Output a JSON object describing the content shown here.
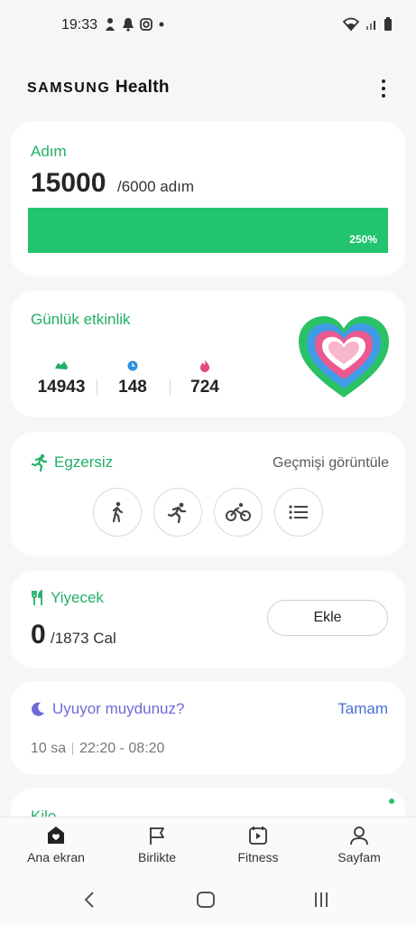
{
  "status_bar": {
    "time": "19:33"
  },
  "header": {
    "brand_samsung": "SAMSUNG",
    "brand_health": "Health"
  },
  "steps": {
    "title": "Adım",
    "value": "15000",
    "goal": "/6000 adım",
    "progress_percent": 250,
    "progress_label": "250%"
  },
  "daily_activity": {
    "title": "Günlük etkinlik",
    "metrics": [
      {
        "icon": "shoe-icon",
        "value": "14943",
        "color": "#20b066"
      },
      {
        "icon": "clock-icon",
        "value": "148",
        "color": "#2b8fe0"
      },
      {
        "icon": "flame-icon",
        "value": "724",
        "color": "#e24a7a"
      }
    ]
  },
  "exercise": {
    "title": "Egzersiz",
    "history_link": "Geçmişi görüntüle",
    "buttons": [
      "walk-icon",
      "run-icon",
      "bike-icon",
      "list-icon"
    ]
  },
  "food": {
    "title": "Yiyecek",
    "value": "0",
    "goal": "/1873 Cal",
    "add_label": "Ekle"
  },
  "sleep": {
    "title": "Uyuyor muydunuz?",
    "ok_label": "Tamam",
    "duration": "10 sa",
    "range": "22:20 - 08:20"
  },
  "weight": {
    "title": "Kilo"
  },
  "bottom_nav": {
    "items": [
      {
        "label": "Ana ekran",
        "icon": "home-icon"
      },
      {
        "label": "Birlikte",
        "icon": "flag-icon"
      },
      {
        "label": "Fitness",
        "icon": "fitness-icon"
      },
      {
        "label": "Sayfam",
        "icon": "person-icon"
      }
    ]
  },
  "colors": {
    "accent_green": "#20b066",
    "progress_green": "#22c470",
    "sleep_purple": "#6c6ad6",
    "link_blue": "#4c6fd3"
  }
}
